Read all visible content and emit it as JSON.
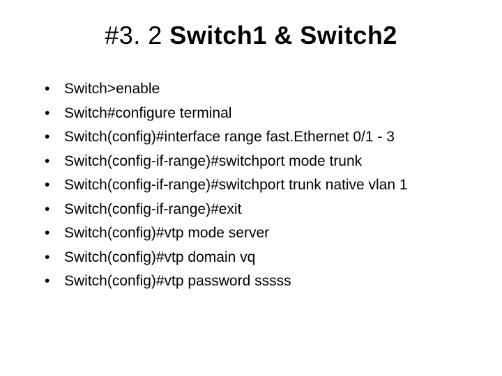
{
  "slide": {
    "title_prefix": "#3. 2 ",
    "title_bold": "Switch1 & Switch2",
    "bullets": [
      "Switch>enable",
      "Switch#configure terminal",
      "Switch(config)#interface range fast.Ethernet 0/1 - 3",
      "Switch(config-if-range)#switchport mode trunk",
      "Switch(config-if-range)#switchport trunk native vlan 1",
      "Switch(config-if-range)#exit",
      "Switch(config)#vtp mode server",
      "Switch(config)#vtp domain vq",
      "Switch(config)#vtp password sssss"
    ]
  }
}
